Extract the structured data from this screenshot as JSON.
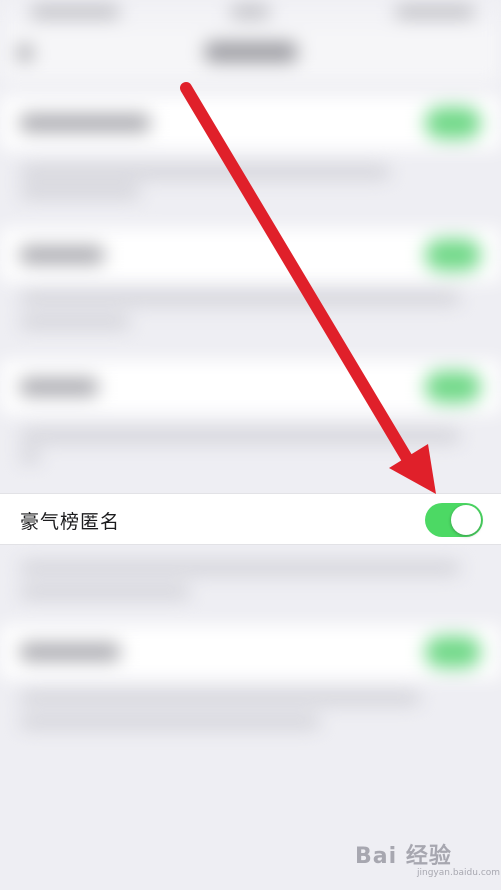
{
  "setting_row": {
    "label": "豪气榜匿名",
    "enabled": true
  },
  "colors": {
    "toggle_on": "#4cd964",
    "arrow": "#e0202a"
  },
  "watermark": {
    "brand": "Bai 经验",
    "sub": "jingyan.baidu.com"
  }
}
